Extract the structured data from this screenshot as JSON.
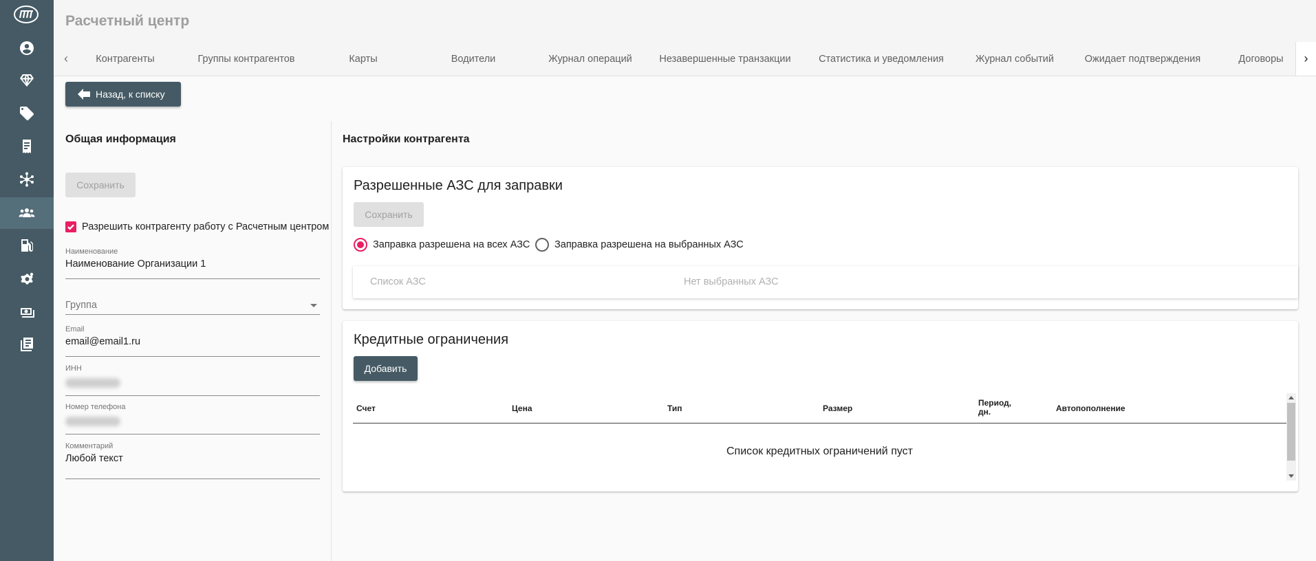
{
  "sidebar": {
    "logo": "logo-icon",
    "items": [
      {
        "icon": "account-circle-icon",
        "active": false
      },
      {
        "icon": "diamond-icon",
        "active": false
      },
      {
        "icon": "tags-icon",
        "active": false
      },
      {
        "icon": "receipt-icon",
        "active": false
      },
      {
        "icon": "network-icon",
        "active": false
      },
      {
        "icon": "users-group-icon",
        "active": true
      },
      {
        "icon": "gas-station-icon",
        "active": false
      },
      {
        "icon": "settings-gear-icon",
        "active": false
      },
      {
        "icon": "cash-icon",
        "active": false
      },
      {
        "icon": "library-books-icon",
        "active": false
      }
    ]
  },
  "header": {
    "title": "Расчетный центр"
  },
  "tabs": [
    "Контрагенты",
    "Группы контрагентов",
    "Карты",
    "Водители",
    "Журнал операций",
    "Незавершенные транзакции",
    "Статистика и уведомления",
    "Журнал событий",
    "Ожидает подтверждения",
    "Договоры"
  ],
  "back_button": {
    "label": "Назад, к списку"
  },
  "general": {
    "heading": "Общая информация",
    "save_label": "Сохранить",
    "checkbox_label": "Разрешить контрагенту работу с Расчетным центром",
    "checkbox_checked": true,
    "name_label": "Наименование",
    "name_value": "Наименование Организации 1",
    "group_placeholder": "Группа",
    "email_label": "Email",
    "email_value": "email@email1.ru",
    "inn_label": "ИНН",
    "phone_label": "Номер телефона",
    "comment_label": "Комментарий",
    "comment_value": "Любой текст"
  },
  "settings": {
    "heading": "Настройки контрагента",
    "stations": {
      "title": "Разрешенные АЗС для заправки",
      "save_label": "Сохранить",
      "radio_all": "Заправка разрешена на всех АЗС",
      "radio_selected": "Заправка разрешена на выбранных АЗС",
      "selected_option": "all",
      "list_placeholder": "Список АЗС",
      "none_selected": "Нет выбранных АЗС"
    },
    "credit": {
      "title": "Кредитные ограничения",
      "add_label": "Добавить",
      "columns": [
        "Счет",
        "Цена",
        "Тип",
        "Размер",
        "Период,",
        "дн.",
        "Автопополнение"
      ],
      "empty_message": "Список кредитных ограничений пуст"
    }
  },
  "colors": {
    "sidebar": "#455a64",
    "accent": "#e91e63",
    "button_dark": "#455a64"
  }
}
